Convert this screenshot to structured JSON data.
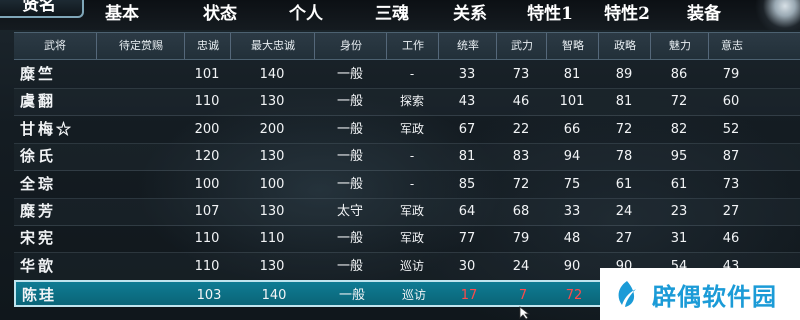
{
  "tabs": [
    {
      "label": "贤名",
      "active": true
    },
    {
      "label": "基本"
    },
    {
      "label": "状态"
    },
    {
      "label": "个人"
    },
    {
      "label": "三魂"
    },
    {
      "label": "关系"
    },
    {
      "label": "特性1"
    },
    {
      "label": "特性2"
    },
    {
      "label": "装备"
    }
  ],
  "table": {
    "headers": [
      "武将",
      "待定赏赐",
      "忠诚",
      "最大忠诚",
      "身份",
      "工作",
      "统率",
      "武力",
      "智略",
      "政略",
      "魅力",
      "意志"
    ],
    "rows": [
      {
        "name": "糜竺",
        "reward": "",
        "loyalty": "101",
        "max_loyalty": "140",
        "status": "一般",
        "job": "-",
        "lead": "33",
        "war": "73",
        "int": "81",
        "pol": "89",
        "cha": "86",
        "will": "79"
      },
      {
        "name": "虞翻",
        "reward": "",
        "loyalty": "110",
        "max_loyalty": "130",
        "status": "一般",
        "job": "探索",
        "lead": "43",
        "war": "46",
        "int": "101",
        "pol": "81",
        "cha": "72",
        "will": "60"
      },
      {
        "name": "甘梅☆",
        "reward": "",
        "loyalty": "200",
        "max_loyalty": "200",
        "status": "一般",
        "job": "军政",
        "lead": "67",
        "war": "22",
        "int": "66",
        "pol": "72",
        "cha": "82",
        "will": "52"
      },
      {
        "name": "徐氏",
        "reward": "",
        "loyalty": "120",
        "max_loyalty": "130",
        "status": "一般",
        "job": "-",
        "lead": "81",
        "war": "83",
        "int": "94",
        "pol": "78",
        "cha": "95",
        "will": "87"
      },
      {
        "name": "全琮",
        "reward": "",
        "loyalty": "100",
        "max_loyalty": "100",
        "status": "一般",
        "job": "-",
        "lead": "85",
        "war": "72",
        "int": "75",
        "pol": "61",
        "cha": "61",
        "will": "73"
      },
      {
        "name": "糜芳",
        "reward": "",
        "loyalty": "107",
        "max_loyalty": "130",
        "status": "太守",
        "job": "军政",
        "lead": "64",
        "war": "68",
        "int": "33",
        "pol": "24",
        "cha": "23",
        "will": "27"
      },
      {
        "name": "宋宪",
        "reward": "",
        "loyalty": "110",
        "max_loyalty": "110",
        "status": "一般",
        "job": "军政",
        "lead": "77",
        "war": "79",
        "int": "48",
        "pol": "27",
        "cha": "31",
        "will": "46"
      },
      {
        "name": "华歆",
        "reward": "",
        "loyalty": "110",
        "max_loyalty": "130",
        "status": "一般",
        "job": "巡访",
        "lead": "30",
        "war": "24",
        "int": "90",
        "pol": "90",
        "cha": "54",
        "will": "43"
      },
      {
        "name": "陈珪",
        "reward": "",
        "loyalty": "103",
        "max_loyalty": "140",
        "status": "一般",
        "job": "巡访",
        "lead": "17",
        "war": "7",
        "int": "72",
        "pol": "",
        "cha": "",
        "will": "",
        "selected": true
      }
    ]
  },
  "colors": {
    "selected_row": "#0f7c94",
    "highlight_value": "#ff4a4a",
    "watermark_text": "#1b9bd7"
  },
  "watermark": {
    "text": "辟偶软件园",
    "icon": "leaf-logo-icon"
  }
}
